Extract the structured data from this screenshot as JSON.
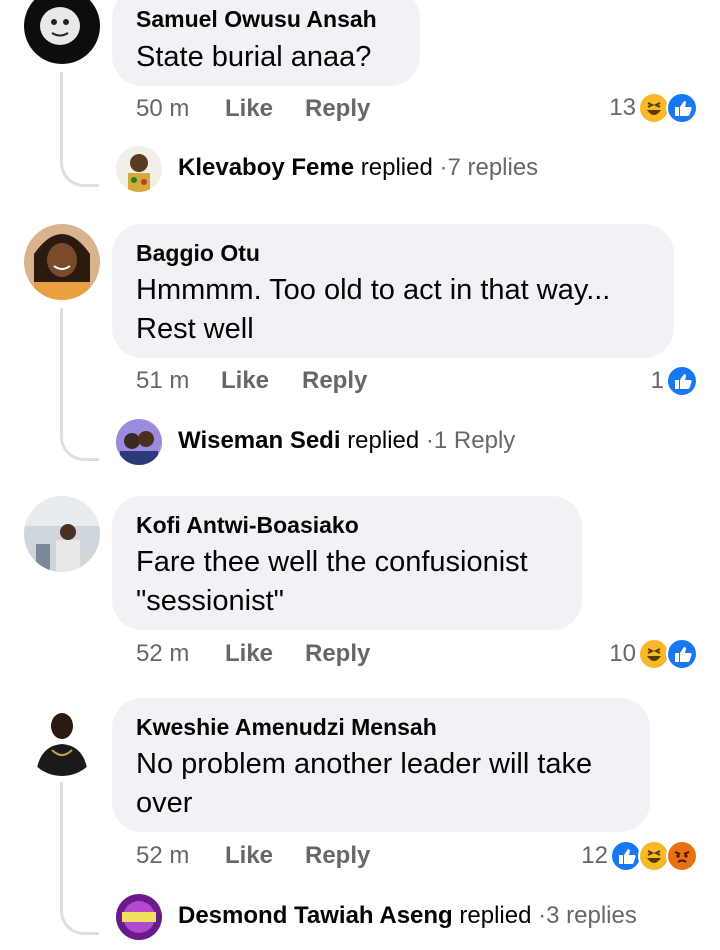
{
  "comments": [
    {
      "author": "Samuel Owusu Ansah",
      "lines": [
        "State burial anaa?"
      ],
      "time": "50 m",
      "like": "Like",
      "reply": "Reply",
      "reaction_count": "13",
      "reactions": [
        "haha",
        "like"
      ],
      "reply_preview": {
        "name": "Klevaboy Feme",
        "verb": "replied",
        "sep": "·",
        "count": "7 replies"
      }
    },
    {
      "author": "Baggio Otu",
      "lines": [
        "Hmmmm. Too old to act in that way...",
        "Rest well"
      ],
      "time": "51 m",
      "like": "Like",
      "reply": "Reply",
      "reaction_count": "1",
      "reactions": [
        "like"
      ],
      "reply_preview": {
        "name": "Wiseman Sedi",
        "verb": "replied",
        "sep": "·",
        "count": "1 Reply"
      }
    },
    {
      "author": "Kofi Antwi-Boasiako",
      "lines": [
        "Fare thee well the confusionist",
        "\"sessionist\""
      ],
      "time": "52 m",
      "like": "Like",
      "reply": "Reply",
      "reaction_count": "10",
      "reactions": [
        "haha",
        "like"
      ]
    },
    {
      "author": "Kweshie Amenudzi Mensah",
      "lines": [
        "No problem another leader will take",
        "over"
      ],
      "time": "52 m",
      "like": "Like",
      "reply": "Reply",
      "reaction_count": "12",
      "reactions": [
        "like",
        "haha",
        "angry"
      ],
      "reply_preview": {
        "name": "Desmond Tawiah Aseng",
        "verb": "replied",
        "sep": "·",
        "count": "3 replies"
      }
    }
  ],
  "colors": {
    "like": "#1877f2",
    "haha": "#f7b928",
    "angry": "#e9710f",
    "bubble": "#f0f2f5",
    "muted": "#65676b"
  }
}
